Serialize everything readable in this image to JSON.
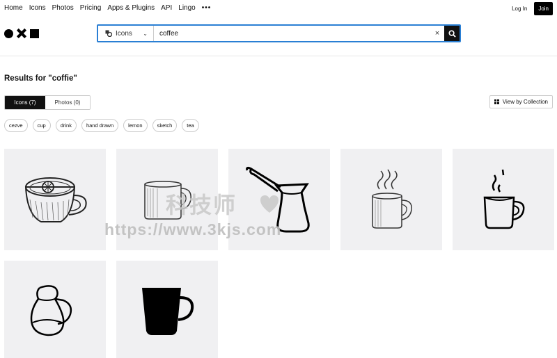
{
  "nav": {
    "links": [
      "Home",
      "Icons",
      "Photos",
      "Pricing",
      "Apps & Plugins",
      "API",
      "Lingo"
    ],
    "more": "•••",
    "login": "Log In",
    "join": "Join"
  },
  "search": {
    "type_label": "Icons",
    "value": "coffee",
    "clear": "×"
  },
  "results": {
    "title": "Results for \"coffie\"",
    "tabs": [
      "Icons (7)",
      "Photos (0)"
    ],
    "view_by_collection": "View by Collection",
    "tags": [
      "cezve",
      "cup",
      "drink",
      "hand drawn",
      "lemon",
      "sketch",
      "tea"
    ]
  },
  "watermark": {
    "top": "科技师",
    "url": "https://www.3kjs.com"
  },
  "tiles": [
    {
      "icon": "lemon-tea-cup-icon"
    },
    {
      "icon": "sketch-mug-icon"
    },
    {
      "icon": "cezve-icon"
    },
    {
      "icon": "steaming-sketch-mug-icon"
    },
    {
      "icon": "steaming-cup-icon"
    },
    {
      "icon": "pitcher-cup-icon"
    },
    {
      "icon": "black-cup-icon"
    }
  ]
}
